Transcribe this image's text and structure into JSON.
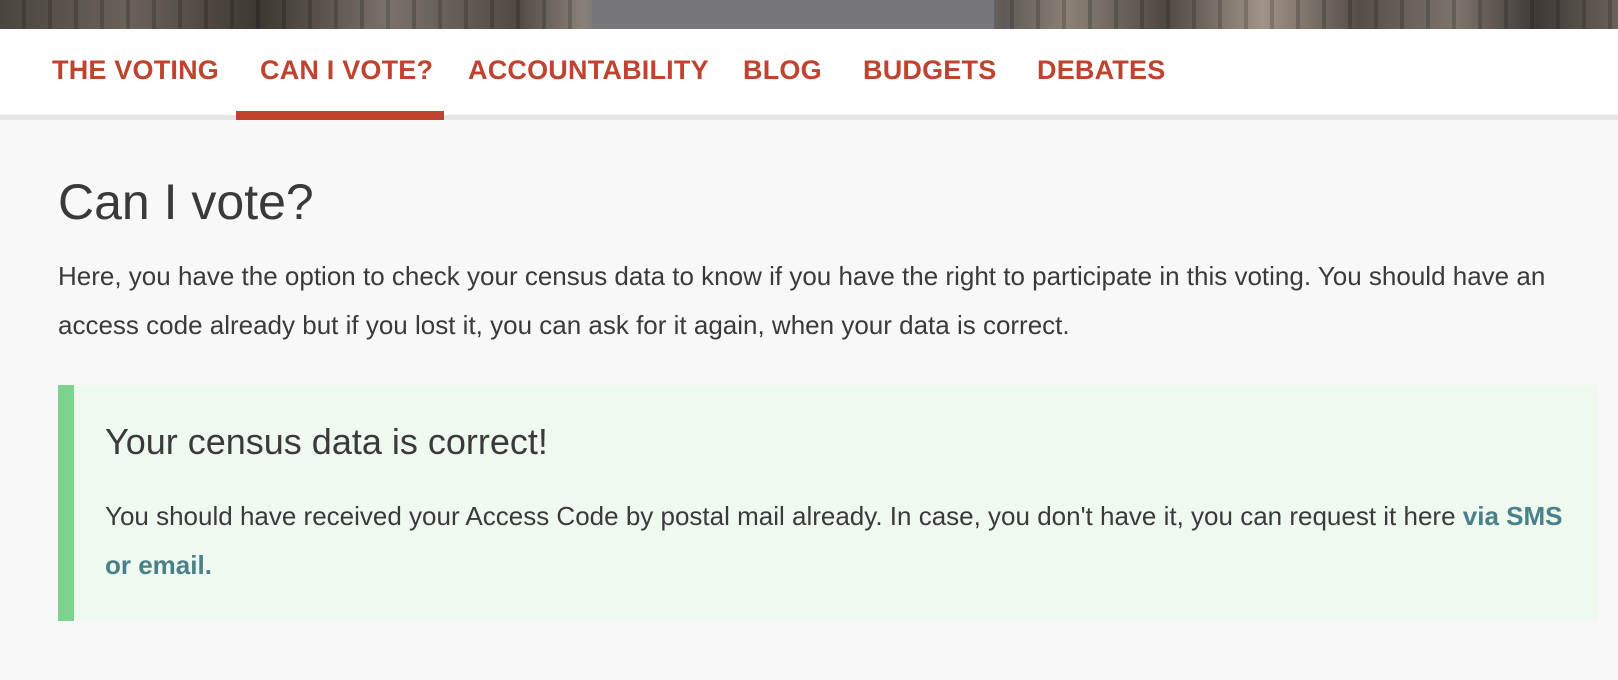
{
  "nav": {
    "items": [
      {
        "label": "THE VOTING",
        "active": false
      },
      {
        "label": "CAN I VOTE?",
        "active": true
      },
      {
        "label": "ACCOUNTABILITY",
        "active": false
      },
      {
        "label": "BLOG",
        "active": false
      },
      {
        "label": "BUDGETS",
        "active": false
      },
      {
        "label": "DEBATES",
        "active": false
      }
    ]
  },
  "main": {
    "title": "Can I vote?",
    "intro": "Here, you have the option to check your census data to know if you have the right to participate in this voting. You should have an access code already but if you lost it, you can ask for it again, when your data is correct."
  },
  "callout": {
    "title": "Your census data is correct!",
    "body": "You should have received your Access Code by postal mail already. In case, you don't have it, you can request it here",
    "link": "via SMS or email."
  },
  "colors": {
    "accent": "#c0432f",
    "success_border": "#7dd38e",
    "success_bg": "#eff9f0",
    "link": "#4a8089"
  }
}
